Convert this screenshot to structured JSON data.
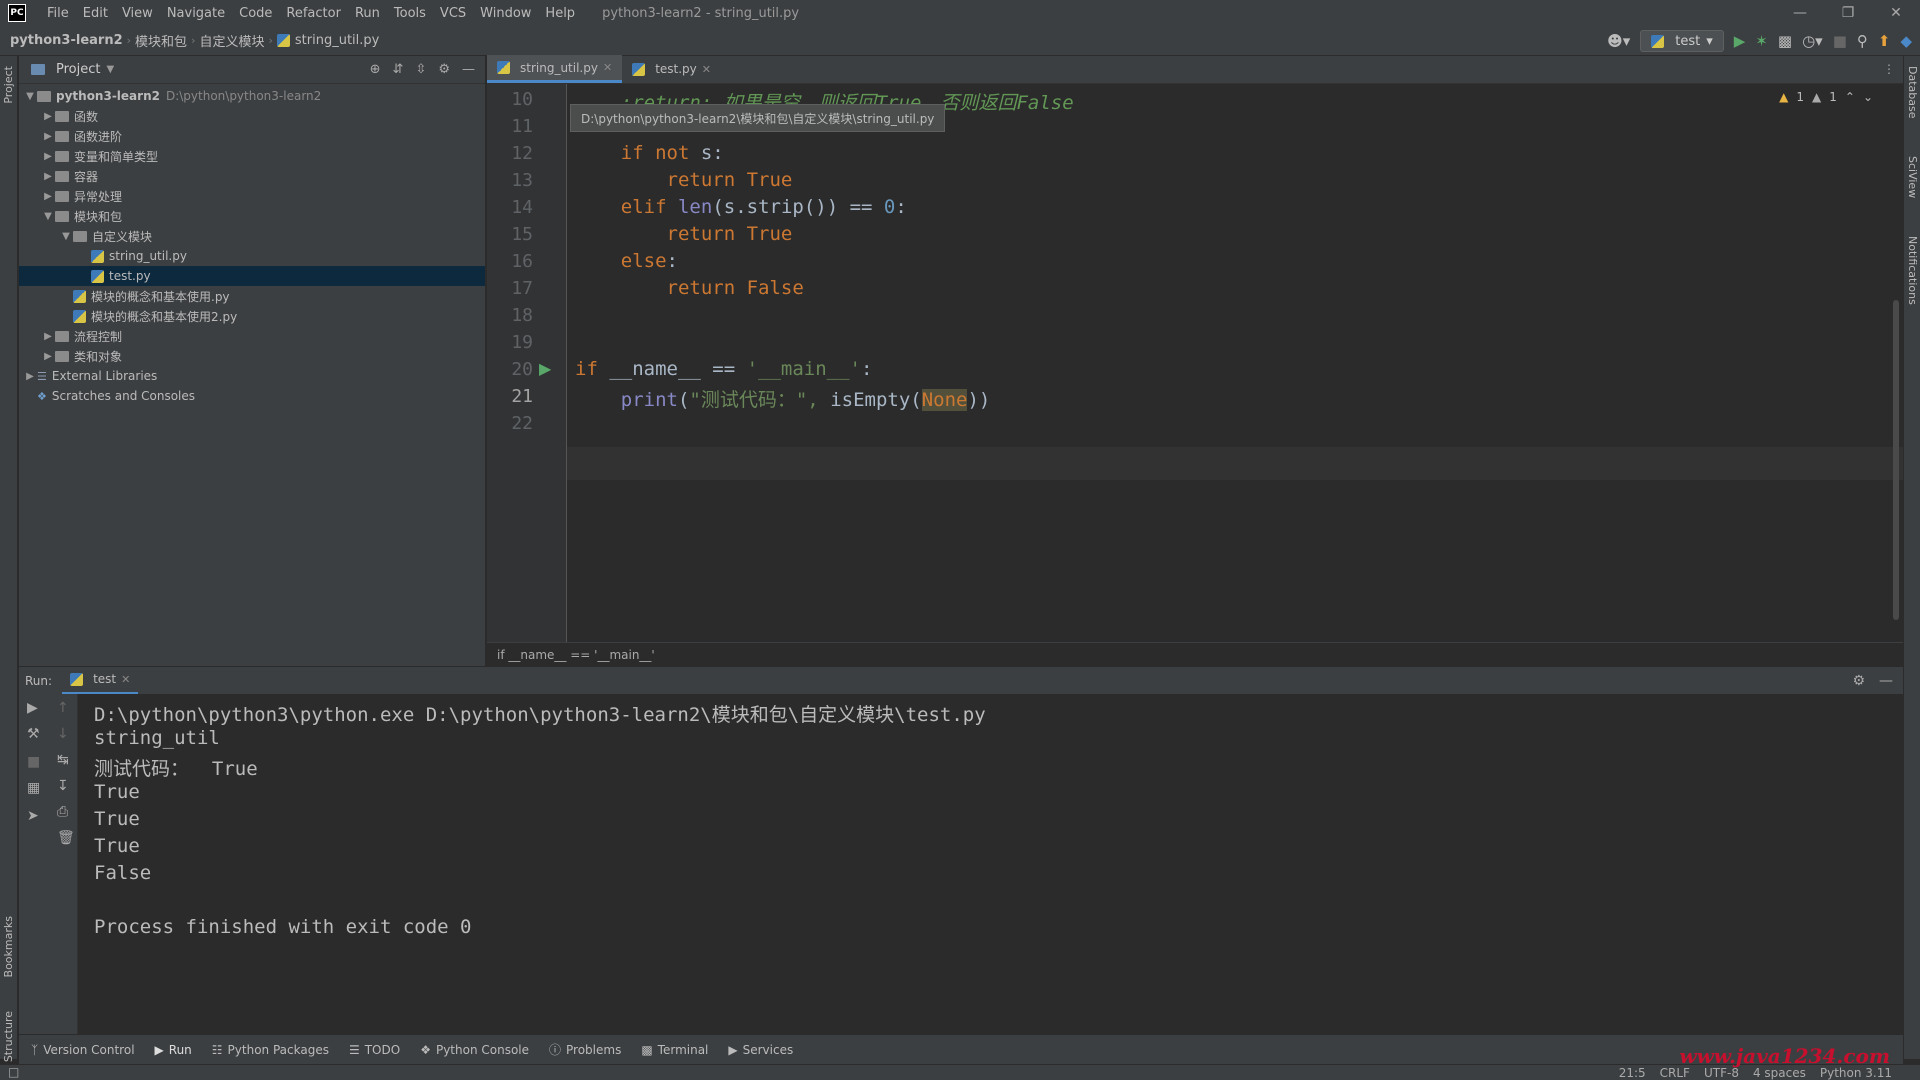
{
  "titlebar": {
    "logo": "PC",
    "menu": [
      "File",
      "Edit",
      "View",
      "Navigate",
      "Code",
      "Refactor",
      "Run",
      "Tools",
      "VCS",
      "Window",
      "Help"
    ],
    "window_title": "python3-learn2 - string_util.py"
  },
  "navbar": {
    "crumbs": [
      "python3-learn2",
      "模块和包",
      "自定义模块",
      "string_util.py"
    ],
    "run_config": "test"
  },
  "project": {
    "header": "Project",
    "tree": [
      {
        "label": "python3-learn2",
        "path": "D:\\python\\python3-learn2"
      },
      {
        "label": "函数"
      },
      {
        "label": "函数进阶"
      },
      {
        "label": "变量和简单类型"
      },
      {
        "label": "容器"
      },
      {
        "label": "异常处理"
      },
      {
        "label": "模块和包"
      },
      {
        "label": "自定义模块"
      },
      {
        "label": "string_util.py"
      },
      {
        "label": "test.py"
      },
      {
        "label": "模块的概念和基本使用.py"
      },
      {
        "label": "模块的概念和基本使用2.py"
      },
      {
        "label": "流程控制"
      },
      {
        "label": "类和对象"
      },
      {
        "label": "External Libraries"
      },
      {
        "label": "Scratches and Consoles"
      }
    ]
  },
  "editor": {
    "tabs": [
      "string_util.py",
      "test.py"
    ],
    "tooltip": "D:\\python\\python3-learn2\\模块和包\\自定义模块\\string_util.py",
    "warnings": [
      "1",
      "1"
    ],
    "line_numbers": [
      "10",
      "11",
      "12",
      "13",
      "14",
      "15",
      "16",
      "17",
      "18",
      "19",
      "20",
      "21",
      "22"
    ],
    "breadcrumb": "if __name__ == '__main__'"
  },
  "run": {
    "label": "Run:",
    "tab": "test",
    "output": [
      "D:\\python\\python3\\python.exe D:\\python\\python3-learn2\\模块和包\\自定义模块\\test.py",
      "string_util",
      "测试代码：  True",
      "True",
      "True",
      "True",
      "False",
      "",
      "Process finished with exit code 0"
    ]
  },
  "bottom_tools": [
    "Version Control",
    "Run",
    "Python Packages",
    "TODO",
    "Python Console",
    "Problems",
    "Terminal",
    "Services"
  ],
  "side": {
    "left": [
      "Project",
      "Bookmarks",
      "Structure"
    ],
    "right": [
      "Database",
      "SciView",
      "Notifications"
    ]
  },
  "status": {
    "position": "21:5",
    "line_sep": "CRLF",
    "encoding": "UTF-8",
    "indent": "4 spaces",
    "interpreter": "Python 3.11"
  },
  "watermark": "www.java1234.com"
}
